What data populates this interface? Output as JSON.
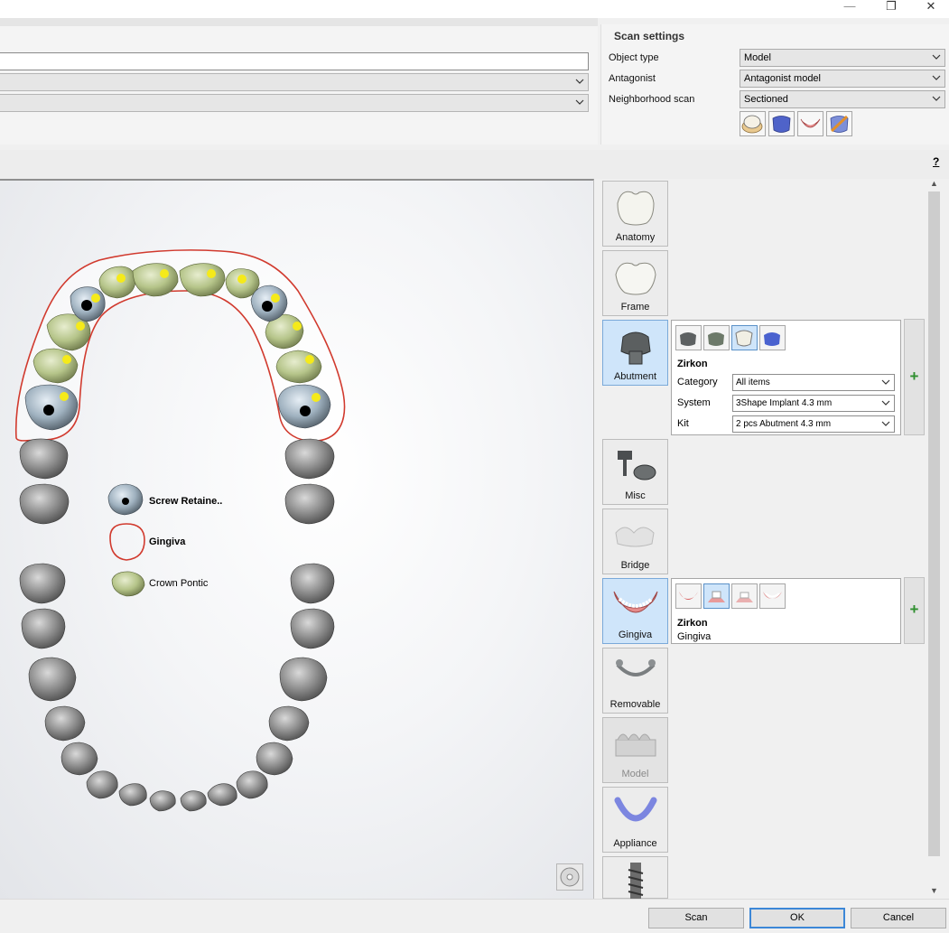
{
  "window": {
    "minimize_glyph": "—",
    "restore_glyph": "❐",
    "close_glyph": "✕"
  },
  "order_form": {
    "field1_value": "",
    "select1_value": "",
    "select2_value": ""
  },
  "scan_settings": {
    "title": "Scan settings",
    "object_type_label": "Object type",
    "object_type_value": "Model",
    "antagonist_label": "Antagonist",
    "antagonist_value": "Antagonist model",
    "neighborhood_label": "Neighborhood scan",
    "neighborhood_value": "Sectioned",
    "icons": [
      "scan-model-icon",
      "scan-die-icon",
      "scan-gingiva-icon",
      "scan-no-scan-icon"
    ]
  },
  "help_label": "?",
  "legend": {
    "screw_retained": "Screw Retaine..",
    "gingiva": "Gingiva",
    "crown_pontic": "Crown Pontic"
  },
  "tiles": [
    {
      "label": "Anatomy"
    },
    {
      "label": "Frame"
    },
    {
      "label": "Abutment"
    },
    {
      "label": "Misc"
    },
    {
      "label": "Bridge"
    },
    {
      "label": "Gingiva"
    },
    {
      "label": "Removable"
    },
    {
      "label": "Model"
    },
    {
      "label": "Appliance"
    }
  ],
  "abutment_panel": {
    "material": "Zirkon",
    "category_label": "Category",
    "category_value": "All items",
    "system_label": "System",
    "system_value": "3Shape Implant 4.3 mm",
    "kit_label": "Kit",
    "kit_value": "2 pcs Abutment 4.3 mm",
    "add_label": "+"
  },
  "gingiva_panel": {
    "material": "Zirkon",
    "type": "Gingiva",
    "add_label": "+"
  },
  "buttons": {
    "scan": "Scan",
    "ok": "OK",
    "cancel": "Cancel"
  },
  "colors": {
    "crown_pontic": "#c5d3a0",
    "screw_retained": "#a9b8c4",
    "gingiva_outline": "#d13a2e",
    "marker_yellow": "#f5ea1a",
    "accent_blue": "#3c87d7"
  }
}
